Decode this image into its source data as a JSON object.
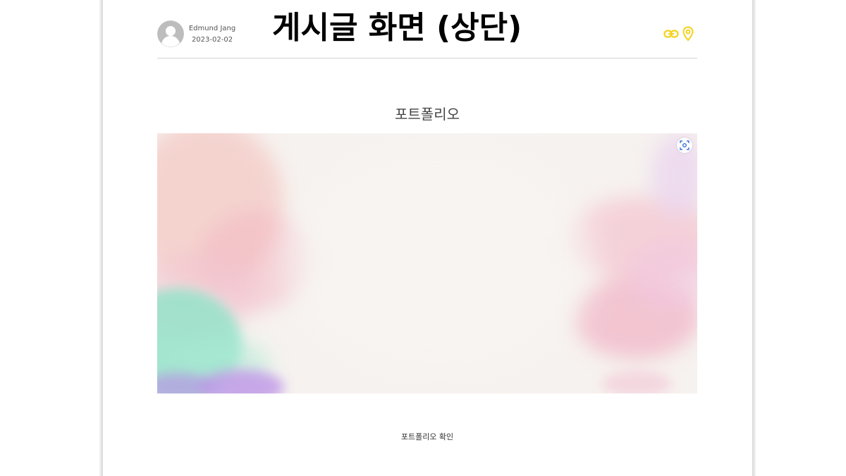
{
  "overlay_caption": "게시글 화면 (상단)",
  "author": {
    "name": "Edmund Jang",
    "date": "2023-02-02",
    "avatar_icon": "default-user-icon"
  },
  "header_icons": [
    {
      "name": "link-icon",
      "color": "#F5D21E"
    },
    {
      "name": "location-pin-icon",
      "color": "#F5D21E"
    }
  ],
  "post": {
    "title": "포트폴리오",
    "image": {
      "description_icon": "watercolor-banner",
      "expand_icon": "fullscreen-icon"
    },
    "link_label": "포트폴리오 확인"
  },
  "colors": {
    "accent": "#F5D21E",
    "divider": "#D4D4D4",
    "avatar_gray": "#BDBDBD"
  }
}
